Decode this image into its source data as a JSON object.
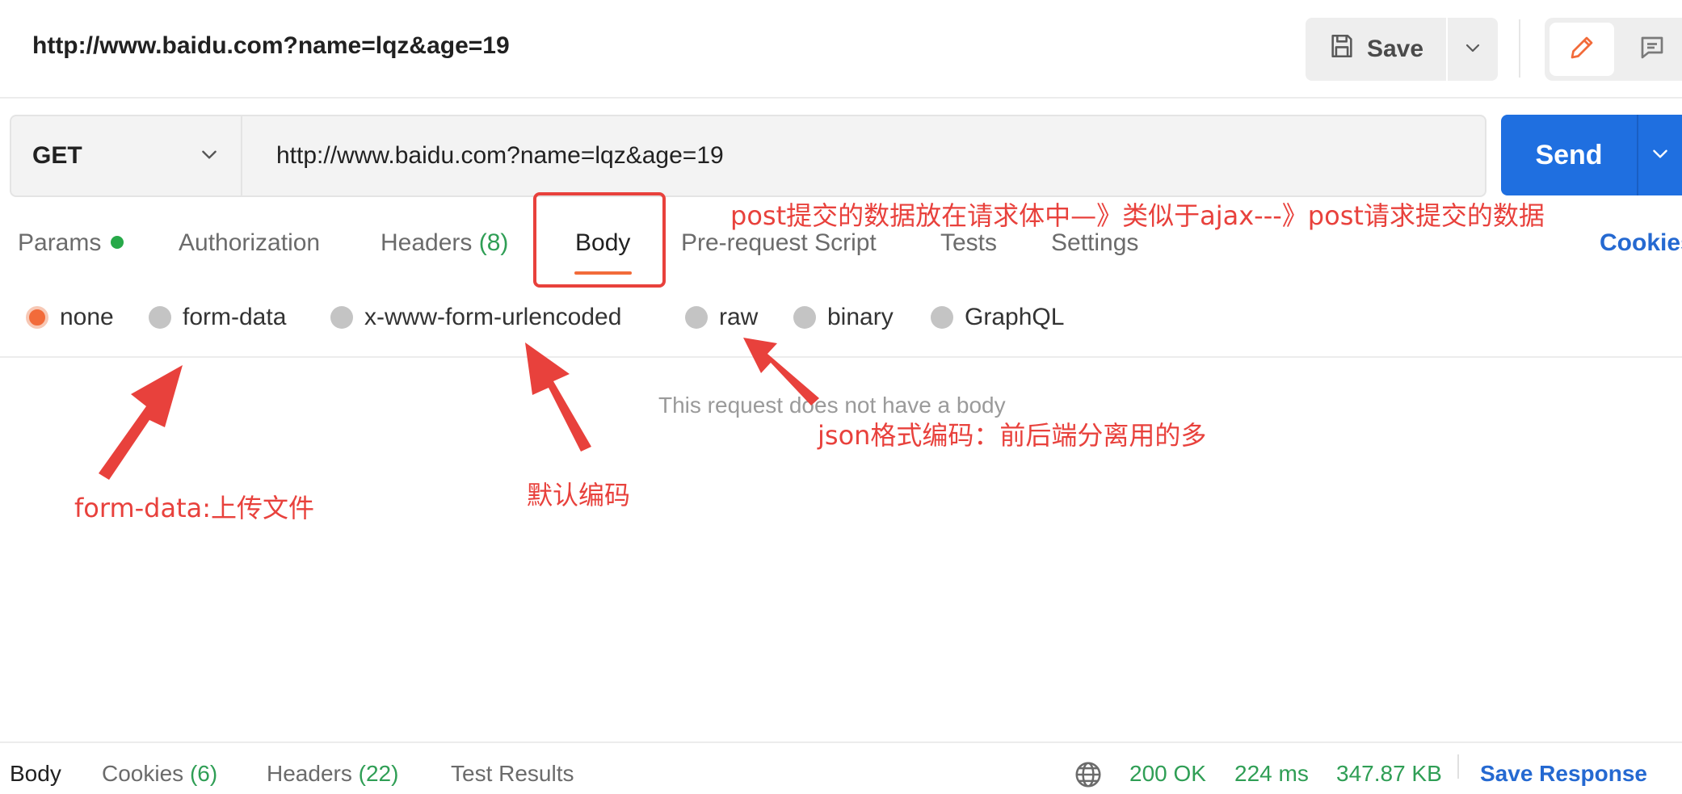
{
  "header": {
    "title": "http://www.baidu.com?name=lqz&age=19",
    "save_label": "Save"
  },
  "request": {
    "method": "GET",
    "url": "http://www.baidu.com?name=lqz&age=19",
    "send_label": "Send"
  },
  "tabs": {
    "params": "Params",
    "authorization": "Authorization",
    "headers": "Headers",
    "headers_count": "(8)",
    "body": "Body",
    "prerequest": "Pre-request Script",
    "tests": "Tests",
    "settings": "Settings",
    "cookies": "Cookies"
  },
  "body_types": {
    "none": "none",
    "form_data": "form-data",
    "urlencoded": "x-www-form-urlencoded",
    "raw": "raw",
    "binary": "binary",
    "graphql": "GraphQL",
    "selected": "none"
  },
  "empty_message": "This request does not have a body",
  "annotations": {
    "post": "post提交的数据放在请求体中—》类似于ajax---》post请求提交的数据",
    "form_data": "form-data:上传文件",
    "default_encoding": "默认编码",
    "raw_json": "json格式编码：前后端分离用的多"
  },
  "response": {
    "body": "Body",
    "cookies": "Cookies",
    "cookies_count": "(6)",
    "headers": "Headers",
    "headers_count": "(22)",
    "test_results": "Test Results",
    "status": "200 OK",
    "time": "224 ms",
    "size": "347.87 KB",
    "save_response": "Save Response"
  },
  "colors": {
    "accent_blue": "#1f6fe0",
    "accent_orange": "#f26b3a",
    "annotation_red": "#e8413c",
    "status_green": "#2f9e55"
  },
  "icons": [
    "save-icon",
    "chevron-down-icon",
    "pencil-icon",
    "comment-icon",
    "globe-icon"
  ]
}
